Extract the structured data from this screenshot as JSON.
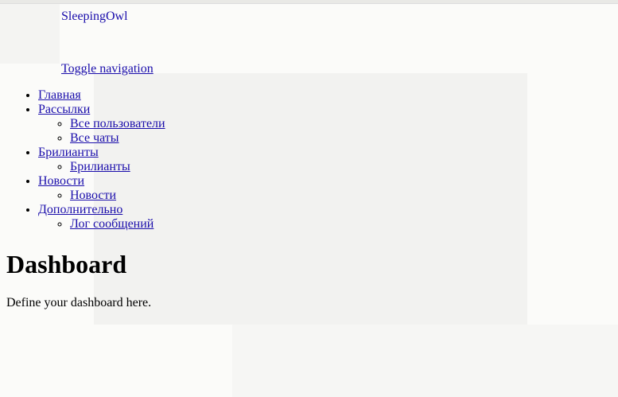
{
  "brand": "SleepingOwl",
  "toggle_navigation": "Toggle navigation",
  "nav": [
    {
      "label": "Главная",
      "children": []
    },
    {
      "label": "Рассылки",
      "children": [
        "Все пользователи",
        "Все чаты"
      ]
    },
    {
      "label": "Брилианты",
      "children": [
        "Брилианты"
      ]
    },
    {
      "label": "Новости",
      "children": [
        "Новости"
      ]
    },
    {
      "label": "Дополнительно",
      "children": [
        "Лог сообщений"
      ]
    }
  ],
  "page_title": "Dashboard",
  "page_description": "Define your dashboard here."
}
